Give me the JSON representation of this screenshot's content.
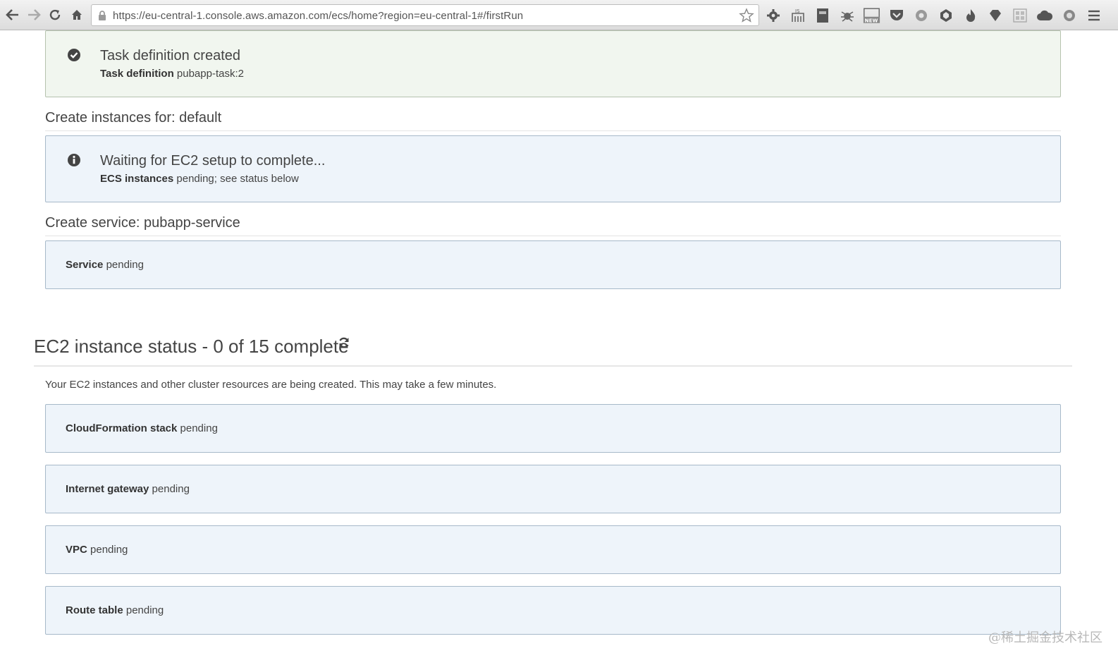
{
  "browser": {
    "url": "https://eu-central-1.console.aws.amazon.com/ecs/home?region=eu-central-1#/firstRun",
    "extension_icons": [
      "gear-icon",
      "fx-icon",
      "book-icon",
      "bug-icon",
      "new-badge-icon",
      "pocket-icon",
      "chrome-icon",
      "globe-icon",
      "flame-icon",
      "diamond-icon",
      "grid-icon",
      "cloud-icon",
      "circle-icon",
      "menu-icon"
    ]
  },
  "task_definition": {
    "title": "Task definition created",
    "label": "Task definition",
    "value": "pubapp-task:2"
  },
  "instances_section": {
    "heading": "Create instances for: default",
    "title": "Waiting for EC2 setup to complete...",
    "label": "ECS instances",
    "value": "pending; see status below"
  },
  "service_section": {
    "heading": "Create service: pubapp-service",
    "label": "Service",
    "value": "pending"
  },
  "ec2_status": {
    "heading": "EC2 instance status - 0 of 15 complete",
    "description": "Your EC2 instances and other cluster resources are being created. This may take a few minutes.",
    "items": [
      {
        "label": "CloudFormation stack",
        "value": "pending"
      },
      {
        "label": "Internet gateway",
        "value": "pending"
      },
      {
        "label": "VPC",
        "value": "pending"
      },
      {
        "label": "Route table",
        "value": "pending"
      }
    ]
  },
  "watermark": "@稀土掘金技术社区",
  "colors": {
    "success_bg": "#f1f6ef",
    "info_bg": "#eef4fa",
    "border": "#a7b9c9"
  }
}
